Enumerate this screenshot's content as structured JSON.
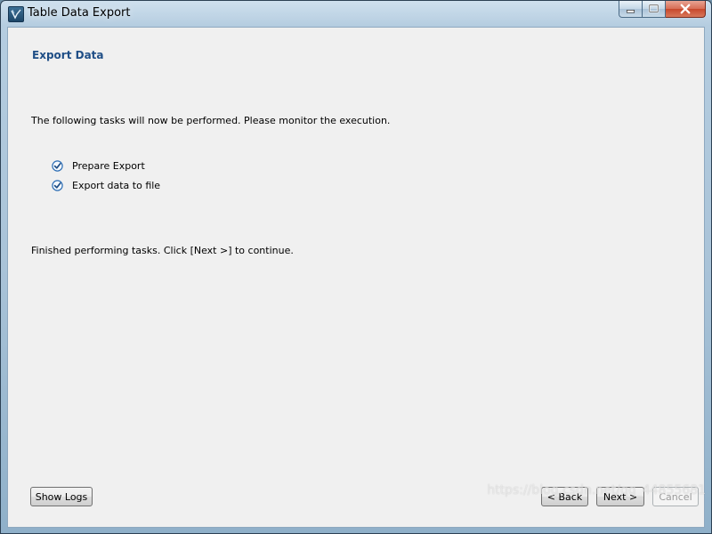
{
  "window": {
    "title": "Table Data Export",
    "icon": "mysql-workbench-icon",
    "controls": [
      "minimize-icon",
      "maximize-icon",
      "close-icon"
    ]
  },
  "page": {
    "heading": "Export Data",
    "intro": "The following tasks will now be performed. Please monitor the execution.",
    "tasks": [
      {
        "label": "Prepare Export",
        "status": "done",
        "icon": "check-circle-icon"
      },
      {
        "label": "Export data to file",
        "status": "done",
        "icon": "check-circle-icon"
      }
    ],
    "finished": "Finished performing tasks. Click [Next >] to continue."
  },
  "footer": {
    "show_logs": "Show Logs",
    "back": "< Back",
    "next": "Next >",
    "cancel": "Cancel"
  },
  "watermark": "https://blog.csdn.net/qq_44855681",
  "colors": {
    "heading": "#1f4e86",
    "check": "#2e6fb5"
  }
}
